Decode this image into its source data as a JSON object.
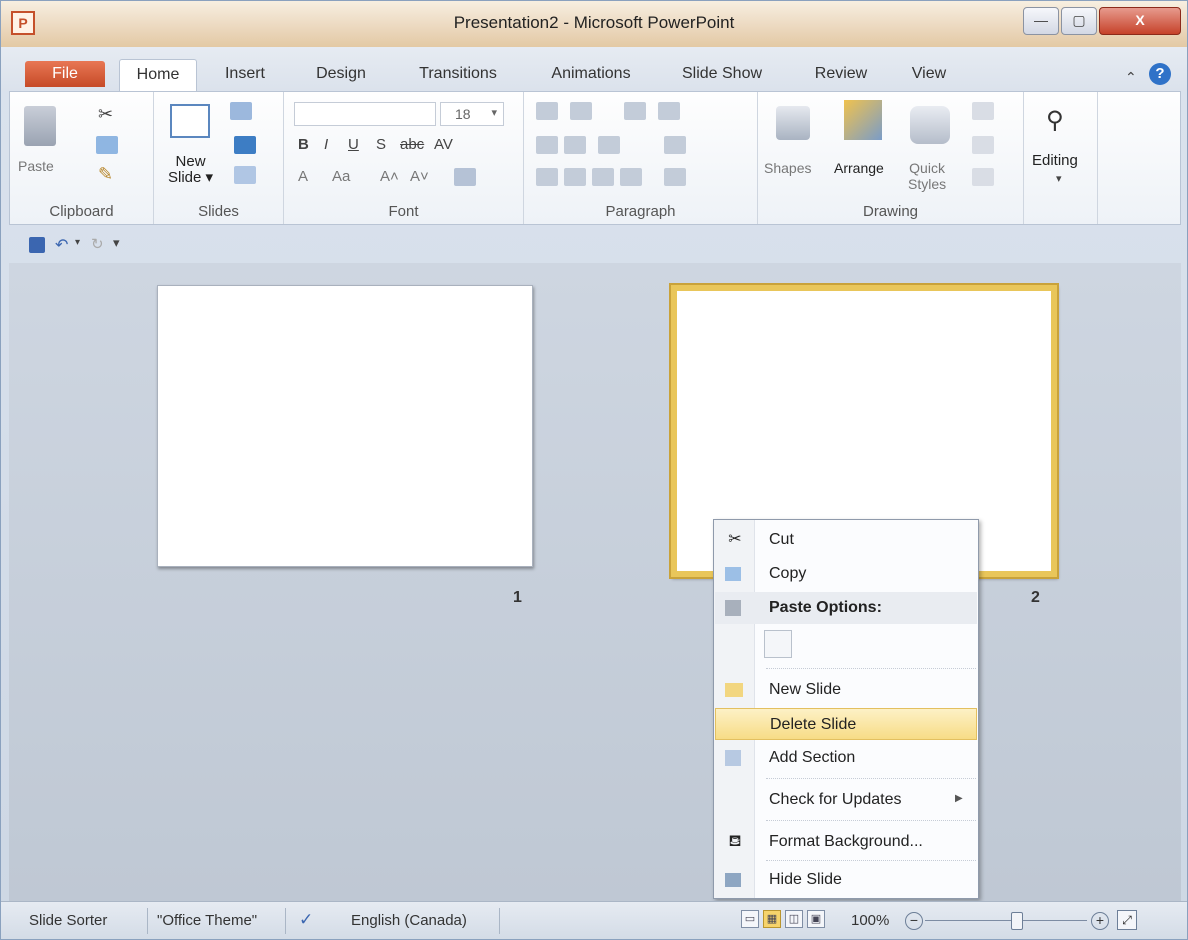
{
  "window": {
    "title": "Presentation2 - Microsoft PowerPoint",
    "app_icon_letter": "P",
    "controls": {
      "minimize": "—",
      "maximize": "▢",
      "close": "X"
    }
  },
  "tabs": [
    "File",
    "Home",
    "Insert",
    "Design",
    "Transitions",
    "Animations",
    "Slide Show",
    "Review",
    "View"
  ],
  "active_tab": "Home",
  "ribbon": {
    "clipboard": {
      "label": "Clipboard",
      "paste": "Paste"
    },
    "slides": {
      "label": "Slides",
      "new_slide_line1": "New",
      "new_slide_line2": "Slide ▾"
    },
    "font": {
      "label": "Font",
      "size": "18",
      "bold": "B",
      "italic": "I",
      "underline": "U",
      "strike": "S",
      "abc": "abc",
      "spacing": "AV",
      "font_color": "A",
      "change_case": "Aa",
      "grow": "A˄",
      "shrink": "A˅"
    },
    "paragraph": {
      "label": "Paragraph"
    },
    "drawing": {
      "label": "Drawing",
      "shapes": "Shapes",
      "arrange": "Arrange",
      "quick_styles_line1": "Quick",
      "quick_styles_line2": "Styles"
    },
    "editing": {
      "label": "Editing"
    }
  },
  "slides": [
    {
      "number": "1"
    },
    {
      "number": "2"
    }
  ],
  "context_menu": {
    "cut": "Cut",
    "copy": "Copy",
    "paste_options": "Paste Options:",
    "new_slide": "New Slide",
    "delete_slide": "Delete Slide",
    "add_section": "Add Section",
    "check_updates": "Check for Updates",
    "format_background": "Format Background...",
    "hide_slide": "Hide Slide"
  },
  "statusbar": {
    "view": "Slide Sorter",
    "theme": "\"Office Theme\"",
    "language": "English (Canada)",
    "zoom": "100%"
  },
  "icons": {
    "cut": "scissors-icon",
    "copy": "copy-icon",
    "paste": "clipboard-icon",
    "new_slide": "new-slide-icon",
    "add_section": "section-icon",
    "format_background": "paint-bucket-icon",
    "hide_slide": "hide-slide-icon",
    "editing": "binoculars-icon"
  },
  "colors": {
    "file_tab": "#c64a27",
    "highlight": "#f7dc86",
    "selection_border": "#e9c65a"
  }
}
